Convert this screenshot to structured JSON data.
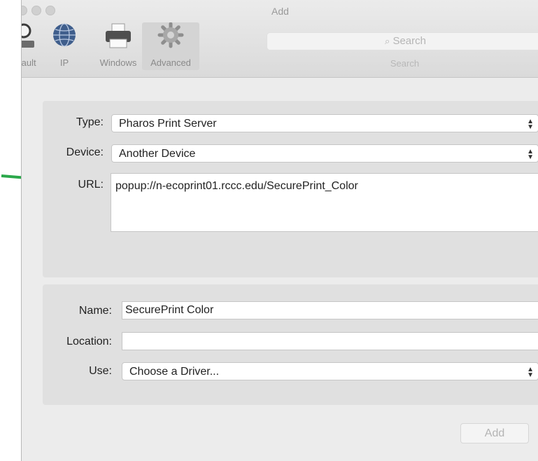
{
  "window": {
    "title": "Add"
  },
  "toolbar": {
    "items": [
      {
        "label": "Default",
        "icon": "magnifier-printer-icon"
      },
      {
        "label": "IP",
        "icon": "globe-icon"
      },
      {
        "label": "Windows",
        "icon": "printer-icon"
      },
      {
        "label": "Advanced",
        "icon": "gear-icon"
      }
    ],
    "selected": "Advanced"
  },
  "search": {
    "placeholder": "Search",
    "label": "Search"
  },
  "connection": {
    "type_label": "Type:",
    "type_value": "Pharos Print Server",
    "device_label": "Device:",
    "device_value": "Another Device",
    "url_label": "URL:",
    "url_value": "popup://n-ecoprint01.rccc.edu/SecurePrint_Color"
  },
  "printer": {
    "name_label": "Name:",
    "name_value": "SecurePrint Color",
    "location_label": "Location:",
    "location_value": "",
    "use_label": "Use:",
    "use_value": "Choose a Driver..."
  },
  "actions": {
    "add_label": "Add"
  },
  "colors": {
    "annotation_arrow": "#2aa84a",
    "window_bg": "#ececec",
    "group_bg": "#e0e0e0"
  }
}
